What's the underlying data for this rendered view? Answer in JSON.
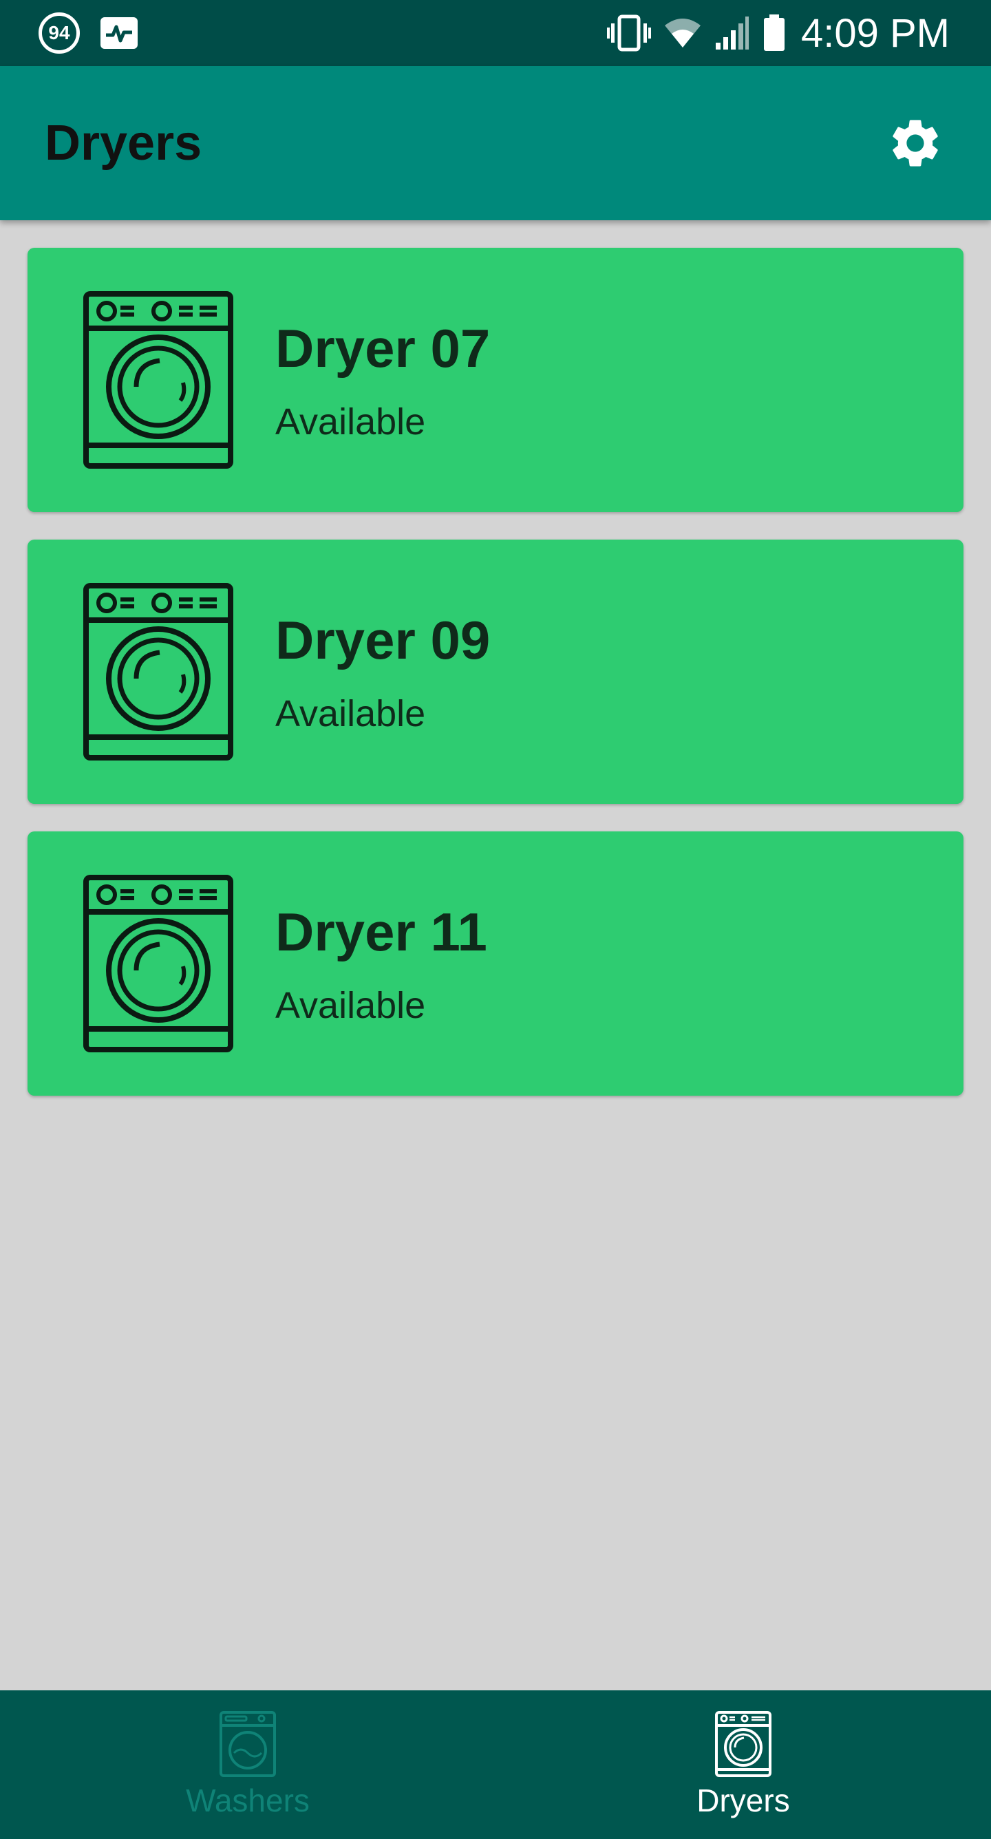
{
  "status_bar": {
    "notification_badge": "94",
    "time": "4:09 PM"
  },
  "app_bar": {
    "title": "Dryers"
  },
  "dryers": [
    {
      "name": "Dryer 07",
      "status": "Available"
    },
    {
      "name": "Dryer 09",
      "status": "Available"
    },
    {
      "name": "Dryer 11",
      "status": "Available"
    }
  ],
  "bottom_nav": {
    "items": [
      {
        "label": "Washers",
        "active": false
      },
      {
        "label": "Dryers",
        "active": true
      }
    ]
  },
  "colors": {
    "status_bar": "#004d48",
    "app_bar": "#00897b",
    "card_available": "#2ecc71",
    "bottom_nav": "#00574f",
    "background": "#d4d4d4"
  }
}
